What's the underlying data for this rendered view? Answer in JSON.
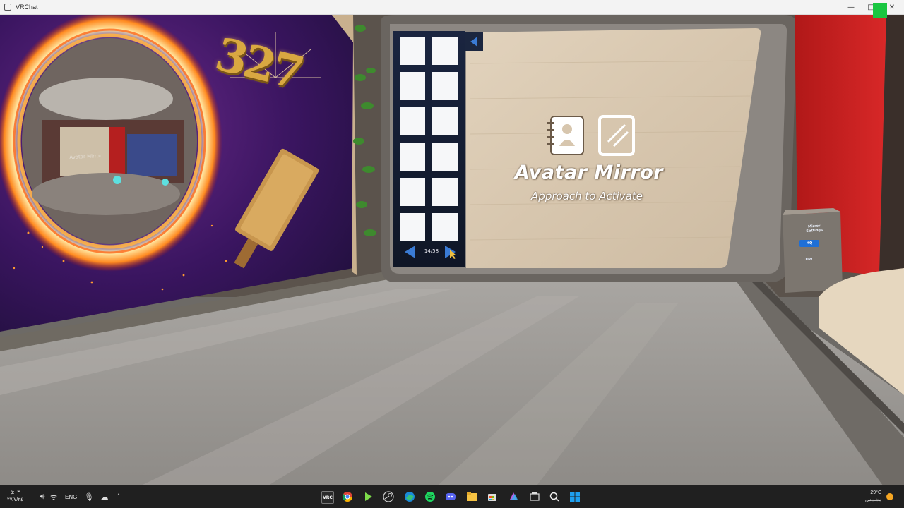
{
  "window": {
    "title": "VRChat",
    "controls": {
      "minimize": "—",
      "maximize": "□",
      "close": "✕"
    }
  },
  "scene": {
    "mirror_board": {
      "title": "Avatar Mirror",
      "subtitle": "Approach to Activate"
    },
    "avatar_panel": {
      "page_indicator": "14/58",
      "slot_count": 12
    },
    "poster": {
      "number": "327",
      "portal_label": "Avatar Mirror"
    },
    "mirror_settings": {
      "title": "Mirror\nSettings",
      "hq_label": "HQ",
      "low_label": "LOW"
    }
  },
  "taskbar": {
    "time": "٥:٠٣",
    "date": "٢٧/٧/٢٤",
    "language": "ENG",
    "weather_temp": "29°C",
    "weather_desc": "مشمس",
    "pinned_icons": [
      "vrchat-icon",
      "chrome-icon",
      "play-icon",
      "steam-icon",
      "edge-icon",
      "spotify-icon",
      "discord-icon",
      "file-explorer-icon",
      "store-icon",
      "copilot-icon",
      "task-view-icon",
      "search-icon",
      "start-icon"
    ],
    "colors": {
      "taskbar": "#202020",
      "start_blue": "#1ea0f0",
      "spotify": "#1ed760",
      "discord": "#5865f2"
    }
  }
}
